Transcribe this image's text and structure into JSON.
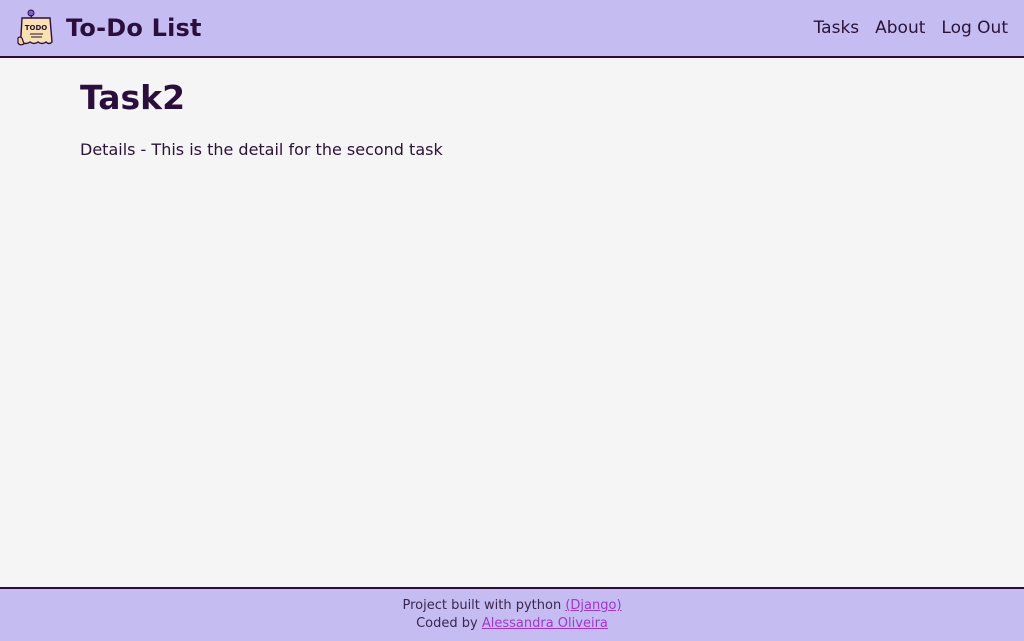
{
  "header": {
    "brand_title": "To-Do List",
    "logo_text": "TODO",
    "logo_icon": "todo-note-icon",
    "nav": [
      {
        "label": "Tasks"
      },
      {
        "label": "About"
      },
      {
        "label": "Log Out"
      }
    ]
  },
  "main": {
    "task_title": "Task2",
    "task_details": "Details - This is the detail for the second task"
  },
  "footer": {
    "line1_text": "Project built with python ",
    "line1_link": "(Django)",
    "line2_text": "Coded by ",
    "line2_link": "Alessandra Oliveira"
  },
  "colors": {
    "header_bg": "#c5bdf2",
    "page_bg": "#f5f5f5",
    "text_dark": "#2a0f3d",
    "link": "#a235d6"
  }
}
